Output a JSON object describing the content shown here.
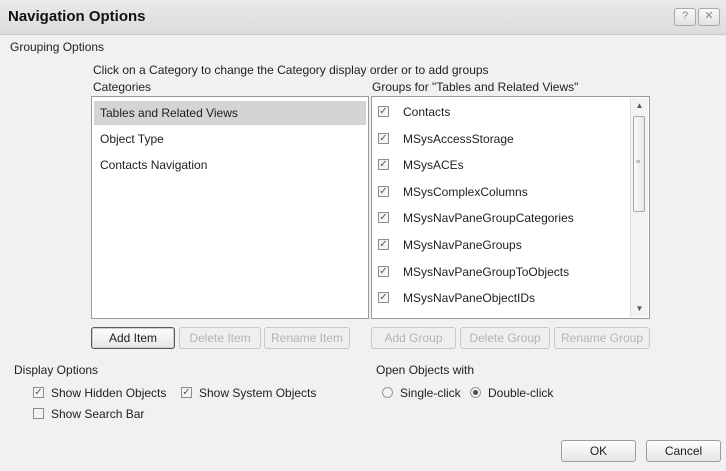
{
  "window": {
    "title": "Navigation Options",
    "help_glyph": "?",
    "close_glyph": "✕"
  },
  "grouping": {
    "section_label": "Grouping Options",
    "instruction": "Click on a Category to change the Category display order or to add groups",
    "categories_header": "Categories",
    "groups_header": "Groups for \"Tables and Related Views\"",
    "categories": [
      {
        "label": "Tables and Related Views",
        "selected": true
      },
      {
        "label": "Object Type",
        "selected": false
      },
      {
        "label": "Contacts Navigation",
        "selected": false
      }
    ],
    "groups": [
      {
        "label": "Contacts",
        "checked": true
      },
      {
        "label": "MSysAccessStorage",
        "checked": true
      },
      {
        "label": "MSysACEs",
        "checked": true
      },
      {
        "label": "MSysComplexColumns",
        "checked": true
      },
      {
        "label": "MSysNavPaneGroupCategories",
        "checked": true
      },
      {
        "label": "MSysNavPaneGroups",
        "checked": true
      },
      {
        "label": "MSysNavPaneGroupToObjects",
        "checked": true
      },
      {
        "label": "MSysNavPaneObjectIDs",
        "checked": true
      }
    ],
    "buttons": {
      "add_item": "Add Item",
      "delete_item": "Delete Item",
      "rename_item": "Rename Item",
      "add_group": "Add Group",
      "delete_group": "Delete Group",
      "rename_group": "Rename Group"
    }
  },
  "display": {
    "section_label": "Display Options",
    "show_hidden": {
      "label": "Show Hidden Objects",
      "checked": true
    },
    "show_system": {
      "label": "Show System Objects",
      "checked": true
    },
    "show_search": {
      "label": "Show Search Bar",
      "checked": false
    }
  },
  "open_with": {
    "section_label": "Open Objects with",
    "single": {
      "label": "Single-click",
      "selected": false
    },
    "double": {
      "label": "Double-click",
      "selected": true
    }
  },
  "footer": {
    "ok": "OK",
    "cancel": "Cancel"
  },
  "icons": {
    "check": "✓",
    "scroll_up": "▲",
    "scroll_down": "▼"
  }
}
